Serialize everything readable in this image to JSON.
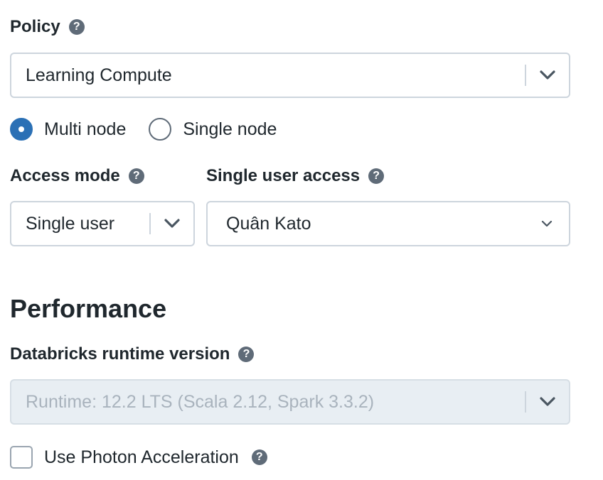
{
  "policy": {
    "label": "Policy",
    "value": "Learning Compute"
  },
  "node_type": {
    "options": [
      "Multi node",
      "Single node"
    ],
    "selected": "Multi node"
  },
  "access_mode": {
    "label": "Access mode",
    "value": "Single user"
  },
  "single_user_access": {
    "label": "Single user access",
    "value": "Quân Kato"
  },
  "performance": {
    "title": "Performance",
    "runtime_label": "Databricks runtime version",
    "runtime_value": "Runtime: 12.2 LTS (Scala 2.12, Spark 3.3.2)",
    "photon_label": "Use Photon Acceleration",
    "photon_checked": false
  },
  "help_glyph": "?",
  "colors": {
    "accent": "#2b70b5",
    "border": "#cdd5dd",
    "help_icon": "#5f6b78",
    "disabled_bg": "#e8eef3",
    "disabled_text": "#a9b3bd"
  }
}
